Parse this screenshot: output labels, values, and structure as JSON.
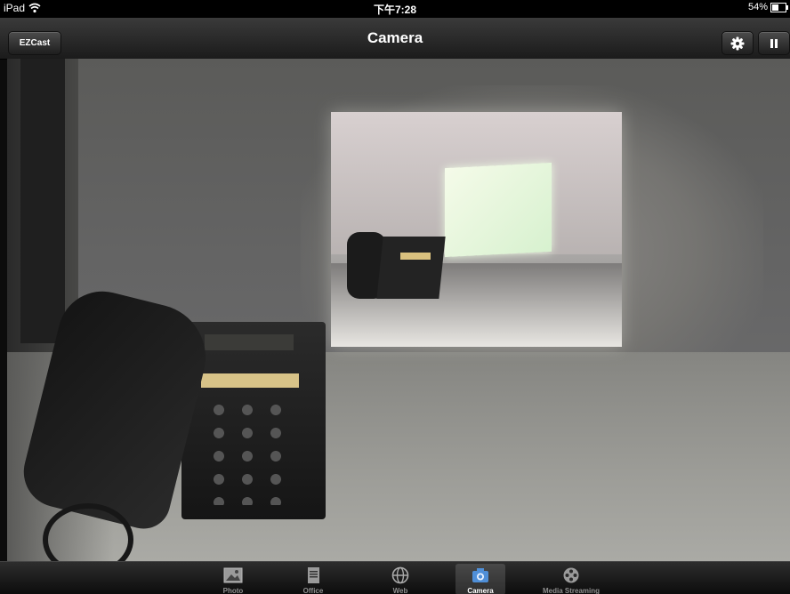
{
  "status_bar": {
    "device": "iPad",
    "time": "下午7:28",
    "battery": "54%"
  },
  "nav_bar": {
    "title": "Camera",
    "left_button": "EZCast",
    "settings_icon": "gear-icon",
    "pause_icon": "pause-icon"
  },
  "camera_view": {
    "description_icon": "live-camera-feed"
  },
  "tab_bar": {
    "tabs": [
      {
        "label": "Photo",
        "icon": "photo-icon",
        "active": false
      },
      {
        "label": "Office",
        "icon": "document-icon",
        "active": false
      },
      {
        "label": "Web",
        "icon": "globe-icon",
        "active": false
      },
      {
        "label": "Camera",
        "icon": "camera-icon",
        "active": true
      },
      {
        "label": "Media Streaming",
        "icon": "film-reel-icon",
        "active": false
      }
    ]
  },
  "colors": {
    "bar_top": "#3a3a3a",
    "bar_bottom": "#1b1b1b",
    "active_tab": "#4f8fd8"
  }
}
